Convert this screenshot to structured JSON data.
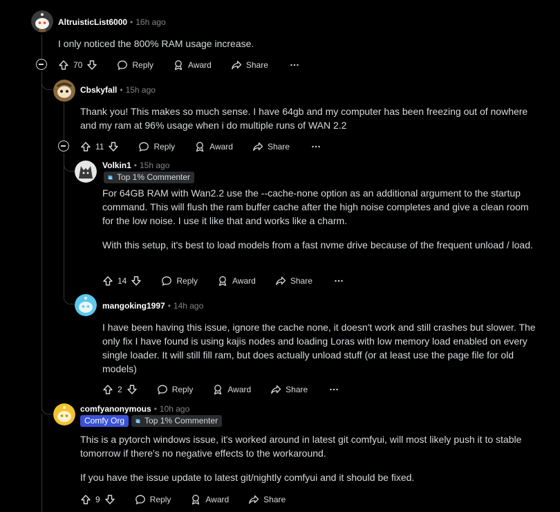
{
  "comments": [
    {
      "author": "AltruisticList6000",
      "time": "16h ago",
      "paragraphs": [
        "I only noticed the 800% RAM usage increase."
      ],
      "votes": "70"
    },
    {
      "author": "Cbskyfall",
      "time": "15h ago",
      "paragraphs": [
        "Thank you! This makes so much sense. I have 64gb and my computer has been freezing out of nowhere and my ram at 96% usage when i do multiple runs of WAN 2.2"
      ],
      "votes": "11"
    },
    {
      "author": "Volkin1",
      "time": "15h ago",
      "flair": "Top 1% Commenter",
      "paragraphs": [
        "For 64GB RAM with Wan2.2 use the --cache-none option as an additional argument to the startup command. This will flush the ram buffer cache after the high noise completes and give a clean room for the low noise. I use it like that and works like a charm.",
        "With this setup, it's best to load models from a fast nvme drive because of the frequent unload / load."
      ],
      "votes": "14"
    },
    {
      "author": "mangoking1997",
      "time": "14h ago",
      "paragraphs": [
        "I have been having this issue, ignore the cache none, it doesn't work and still crashes but slower. The only fix I have found is using kajis nodes and loading Loras with low memory load enabled on every single loader.  It will still fill ram, but does actually unload stuff (or at least use the page file for old models)"
      ],
      "votes": "2"
    },
    {
      "author": "comfyanonymous",
      "time": "10h ago",
      "org_badge": "Comfy Org",
      "flair": "Top 1% Commenter",
      "paragraphs": [
        "This is a pytorch windows issue, it's worked around in latest git comfyui, will most likely push it to stable tomorrow if there's no negative effects to the workaround.",
        "If you have the issue update to latest git/nightly comfyui and it should be fixed."
      ],
      "votes": "9"
    }
  ],
  "actions": {
    "reply": "Reply",
    "award": "Award",
    "share": "Share"
  },
  "separator": "•",
  "icons": [
    "upvote-icon",
    "downvote-icon",
    "reply-icon",
    "award-icon",
    "share-icon",
    "more-icon",
    "collapse-icon",
    "flair-icon"
  ],
  "colors": {
    "background": "#000000",
    "text": "#d7dadc",
    "muted": "#818384",
    "org_badge": "#3a52d6",
    "thread_line": "#343536"
  }
}
